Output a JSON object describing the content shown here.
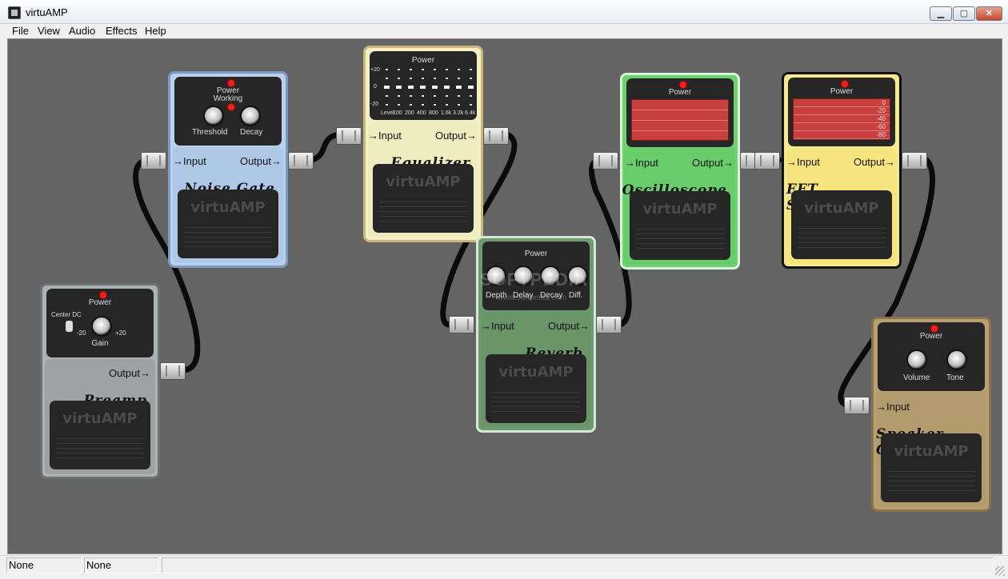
{
  "window": {
    "title": "virtuAMP",
    "controls": {
      "minimize": "▁",
      "maximize": "▢",
      "close": "✕"
    }
  },
  "menu": [
    "File",
    "View",
    "Audio",
    "Effects",
    "Help"
  ],
  "brand": "virtuAMP",
  "watermark": "SOFTPEDIA",
  "watermark_sub": "www.softpedia.com",
  "pedals": {
    "preamp": {
      "name": "Preamp",
      "power": "Power",
      "center_dc": "Center DC",
      "min": "-20",
      "max": "+20",
      "knob": "Gain",
      "output": "Output→",
      "color": "#aeb2b3"
    },
    "noise_gate": {
      "name": "Noise Gate",
      "power": "Power",
      "working": "Working",
      "knobs": [
        "Threshold",
        "Decay"
      ],
      "input": "→Input",
      "output": "Output→",
      "color": "#b9d1ef"
    },
    "equalizer": {
      "name": "Equalizer",
      "power": "Power",
      "scale": [
        "+20",
        "0",
        "-20"
      ],
      "bands": [
        "Level",
        "100",
        "200",
        "400",
        "800",
        "1.6k",
        "3.2k",
        "6.4k"
      ],
      "input": "→Input",
      "output": "Output→",
      "color": "#f4efc9"
    },
    "reverb": {
      "name": "Reverb",
      "power": "Power",
      "knobs": [
        "Depth",
        "Delay",
        "Decay",
        "Diff."
      ],
      "input": "→Input",
      "output": "Output→",
      "color": "#6f9a70"
    },
    "oscilloscope": {
      "name": "Oscilloscope",
      "power": "Power",
      "input": "→Input",
      "output": "Output→",
      "color": "#6fd071"
    },
    "fft": {
      "name": "FFT Spectrum",
      "power": "Power",
      "scale": [
        "0",
        "-20",
        "-40",
        "-60",
        "-80"
      ],
      "input": "→Input",
      "output": "Output→",
      "color": "#f8e98e"
    },
    "speaker": {
      "name": "Speaker Cabnit",
      "power": "Power",
      "knobs": [
        "Volume",
        "Tone"
      ],
      "input": "→Input",
      "color": "#b8a074"
    }
  },
  "status": [
    "None",
    "None"
  ]
}
